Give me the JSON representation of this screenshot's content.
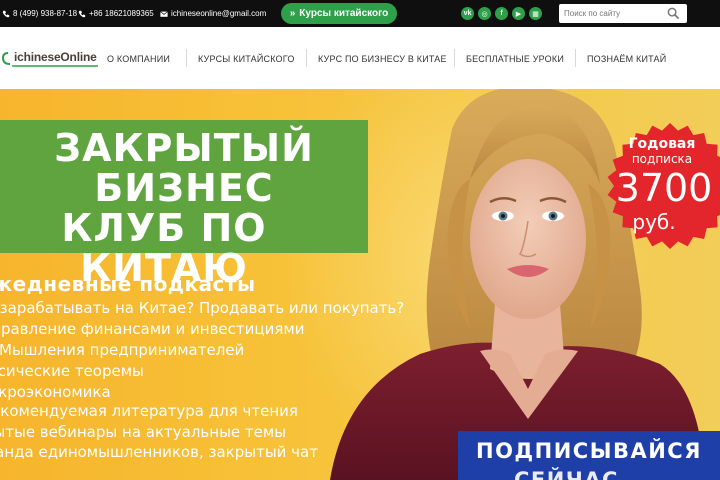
{
  "topbar": {
    "phone1": "8 (499) 938-87-18",
    "phone2": "+86 18621089365",
    "email": "ichineseonline@gmail.com",
    "cta_label": "Курсы китайского",
    "socials": [
      {
        "name": "vk-icon",
        "glyph": "vk"
      },
      {
        "name": "instagram-icon",
        "glyph": "◎"
      },
      {
        "name": "facebook-icon",
        "glyph": "f"
      },
      {
        "name": "youtube-icon",
        "glyph": "▶"
      },
      {
        "name": "calendar-icon",
        "glyph": "▦"
      }
    ],
    "search_placeholder": "Поиск по сайту"
  },
  "nav": {
    "logo": "ichineseOnline",
    "items": [
      "О КОМПАНИИ",
      "КУРСЫ КИТАЙСКОГО",
      "КУРС ПО БИЗНЕСУ В КИТАЕ",
      "БЕСПЛАТНЫЕ УРОКИ",
      "ПОЗНАЁМ КИТАЙ"
    ]
  },
  "hero": {
    "title_lines": [
      "ЗАКРЫТЫЙ",
      "БИЗНЕС",
      "КЛУБ ПО КИТАЮ"
    ],
    "subheading": "Ежедневные подкасты",
    "bullets": [
      "Как зарабатывать на Китае? Продавать или покупать?",
      "Управление финансами и инвестициями",
      "Мышления предпринимателей",
      "Классические теоремы",
      "Макроэкономика",
      "Рекомендуемая литература для чтения",
      "Закрытые вебинары на актуальные темы",
      "Команда единомышленников, закрытый чат"
    ],
    "badge": {
      "line1": "Годовая",
      "line2": "подписка",
      "price": "3700",
      "currency": "руб."
    },
    "subscribe_line1": "ПОДПИСЫВАЙСЯ",
    "subscribe_line2": "СЕЙЧАС"
  },
  "colors": {
    "topbar_bg": "#0f0f0f",
    "accent_green": "#2ea04a",
    "title_green": "#5fa43f",
    "hero_yellow": "#f6b52d",
    "badge_red": "#e3262b",
    "subscribe_blue": "#1f3fa8"
  }
}
